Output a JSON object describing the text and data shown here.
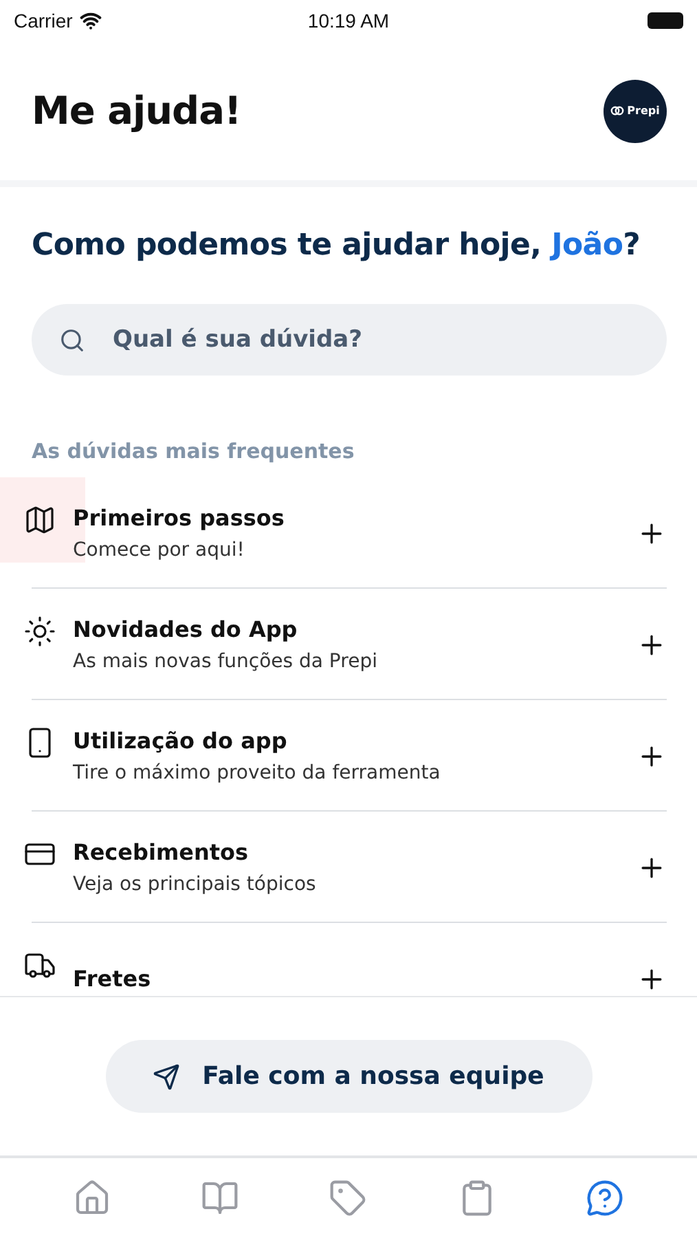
{
  "status_bar": {
    "carrier": "Carrier",
    "time": "10:19 AM"
  },
  "header": {
    "title": "Me ajuda!",
    "logo": "Prepi"
  },
  "greeting": {
    "text": "Como podemos te ajudar hoje, ",
    "name": "João",
    "end": "?"
  },
  "search": {
    "placeholder": "Qual é sua dúvida?"
  },
  "section_title": "As dúvidas mais frequentes",
  "faq": [
    {
      "kind": "map",
      "title": "Primeiros passos",
      "subtitle": "Comece por aqui!",
      "highlighted": true,
      "expanded": false
    },
    {
      "kind": "sun",
      "title": "Novidades do App",
      "subtitle": "As mais novas funções da Prepi",
      "highlighted": false,
      "expanded": false
    },
    {
      "kind": "phone",
      "title": "Utilização do app",
      "subtitle": "Tire o máximo proveito da ferramenta",
      "highlighted": false,
      "expanded": false
    },
    {
      "kind": "card",
      "title": "Recebimentos",
      "subtitle": "Veja os principais tópicos",
      "highlighted": false,
      "expanded": false
    },
    {
      "kind": "truck",
      "title": "Fretes",
      "highlighted": false,
      "expanded": false
    }
  ],
  "contact_button": "Fale com a nossa equipe",
  "tab_bar": [
    {
      "kind": "home",
      "selected": false
    },
    {
      "kind": "book",
      "selected": false
    },
    {
      "kind": "tag",
      "selected": false
    },
    {
      "kind": "clipboard",
      "selected": false
    },
    {
      "kind": "help",
      "selected": true
    }
  ]
}
